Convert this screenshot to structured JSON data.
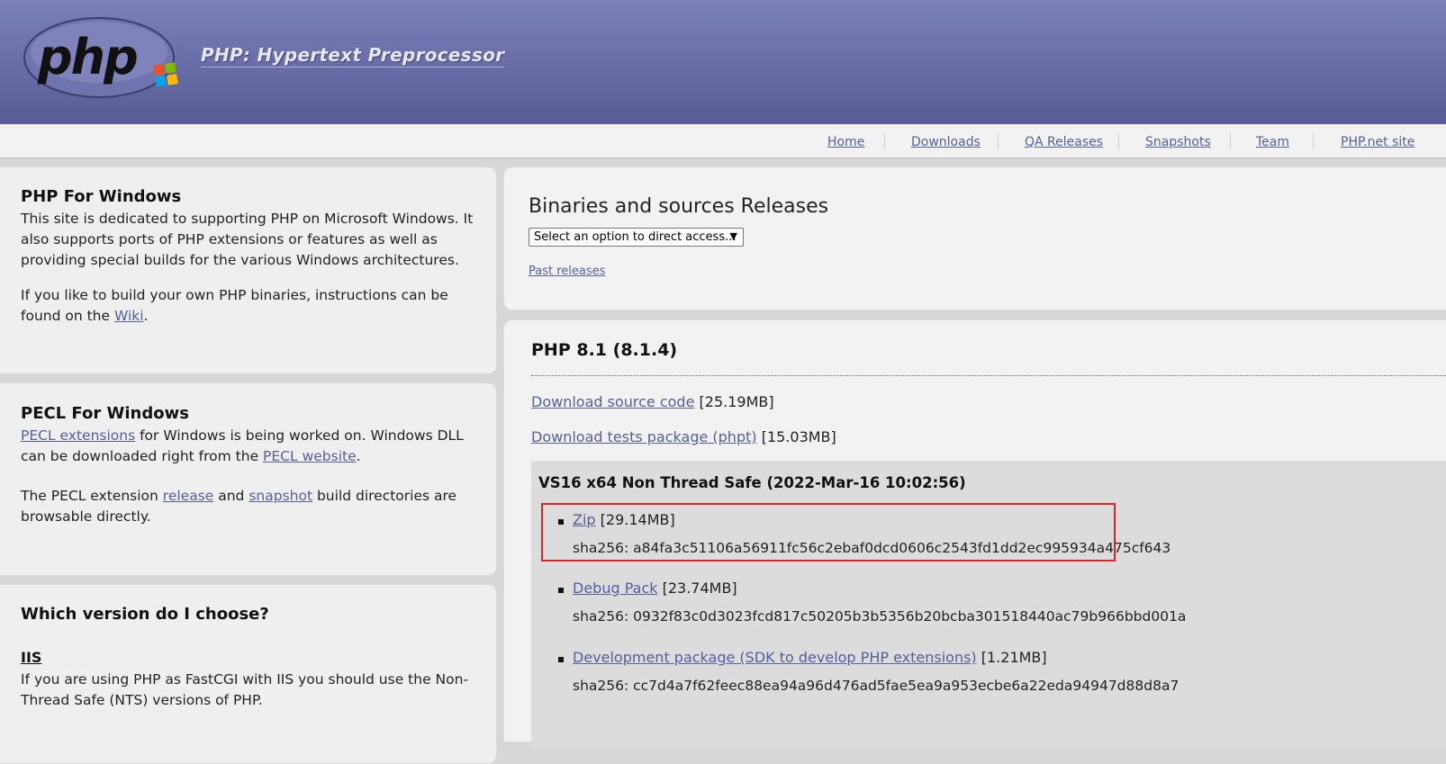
{
  "header": {
    "tagline": "PHP: Hypertext Preprocessor",
    "logo_text": "php"
  },
  "nav": {
    "items": [
      "Home",
      "Downloads",
      "QA Releases",
      "Snapshots",
      "Team",
      "PHP.net site"
    ]
  },
  "left": {
    "php_windows": {
      "title": "PHP For Windows",
      "p1": "This site is dedicated to supporting PHP on Microsoft Windows. It also supports ports of PHP extensions or features as well as providing special builds for the various Windows architectures.",
      "p2_pre": "If you like to build your own PHP binaries, instructions can be found on the ",
      "p2_link": "Wiki",
      "p2_post": "."
    },
    "pecl": {
      "title": "PECL For Windows",
      "p1_link1": "PECL extensions",
      "p1_mid": " for Windows is being worked on. Windows DLL can be downloaded right from the ",
      "p1_link2": "PECL website",
      "p1_post": ".",
      "p2_pre": "The PECL extension ",
      "p2_link1": "release",
      "p2_mid": " and ",
      "p2_link2": "snapshot",
      "p2_post": " build directories are browsable directly."
    },
    "version": {
      "title": "Which version do I choose?",
      "iis_heading": "IIS",
      "iis_text": "If you are using PHP as FastCGI with IIS you should use the Non-Thread Safe (NTS) versions of PHP."
    }
  },
  "releases": {
    "title": "Binaries and sources Releases",
    "select_value": "Select an option to direct access...",
    "past_releases": "Past releases"
  },
  "php81": {
    "title": "PHP 8.1 (8.1.4)",
    "source_link": "Download source code",
    "source_size": "[25.19MB]",
    "tests_link": "Download tests package (phpt)",
    "tests_size": "[15.03MB]",
    "build": {
      "title": "VS16 x64 Non Thread Safe (2022-Mar-16 10:02:56)",
      "files": [
        {
          "link": "Zip",
          "size": "[29.14MB]",
          "sha": "sha256: a84fa3c51106a56911fc56c2ebaf0dcd0606c2543fd1dd2ec995934a475cf643"
        },
        {
          "link": "Debug Pack",
          "size": "[23.74MB]",
          "sha": "sha256: 0932f83c0d3023fcd817c50205b3b5356b20bcba301518440ac79b966bbd001a"
        },
        {
          "link": "Development package (SDK to develop PHP extensions)",
          "size": "[1.21MB]",
          "sha": "sha256: cc7d4a7f62feec88ea94a96d476ad5fae5ea9a953ecbe6a22eda94947d88d8a7"
        }
      ]
    }
  }
}
